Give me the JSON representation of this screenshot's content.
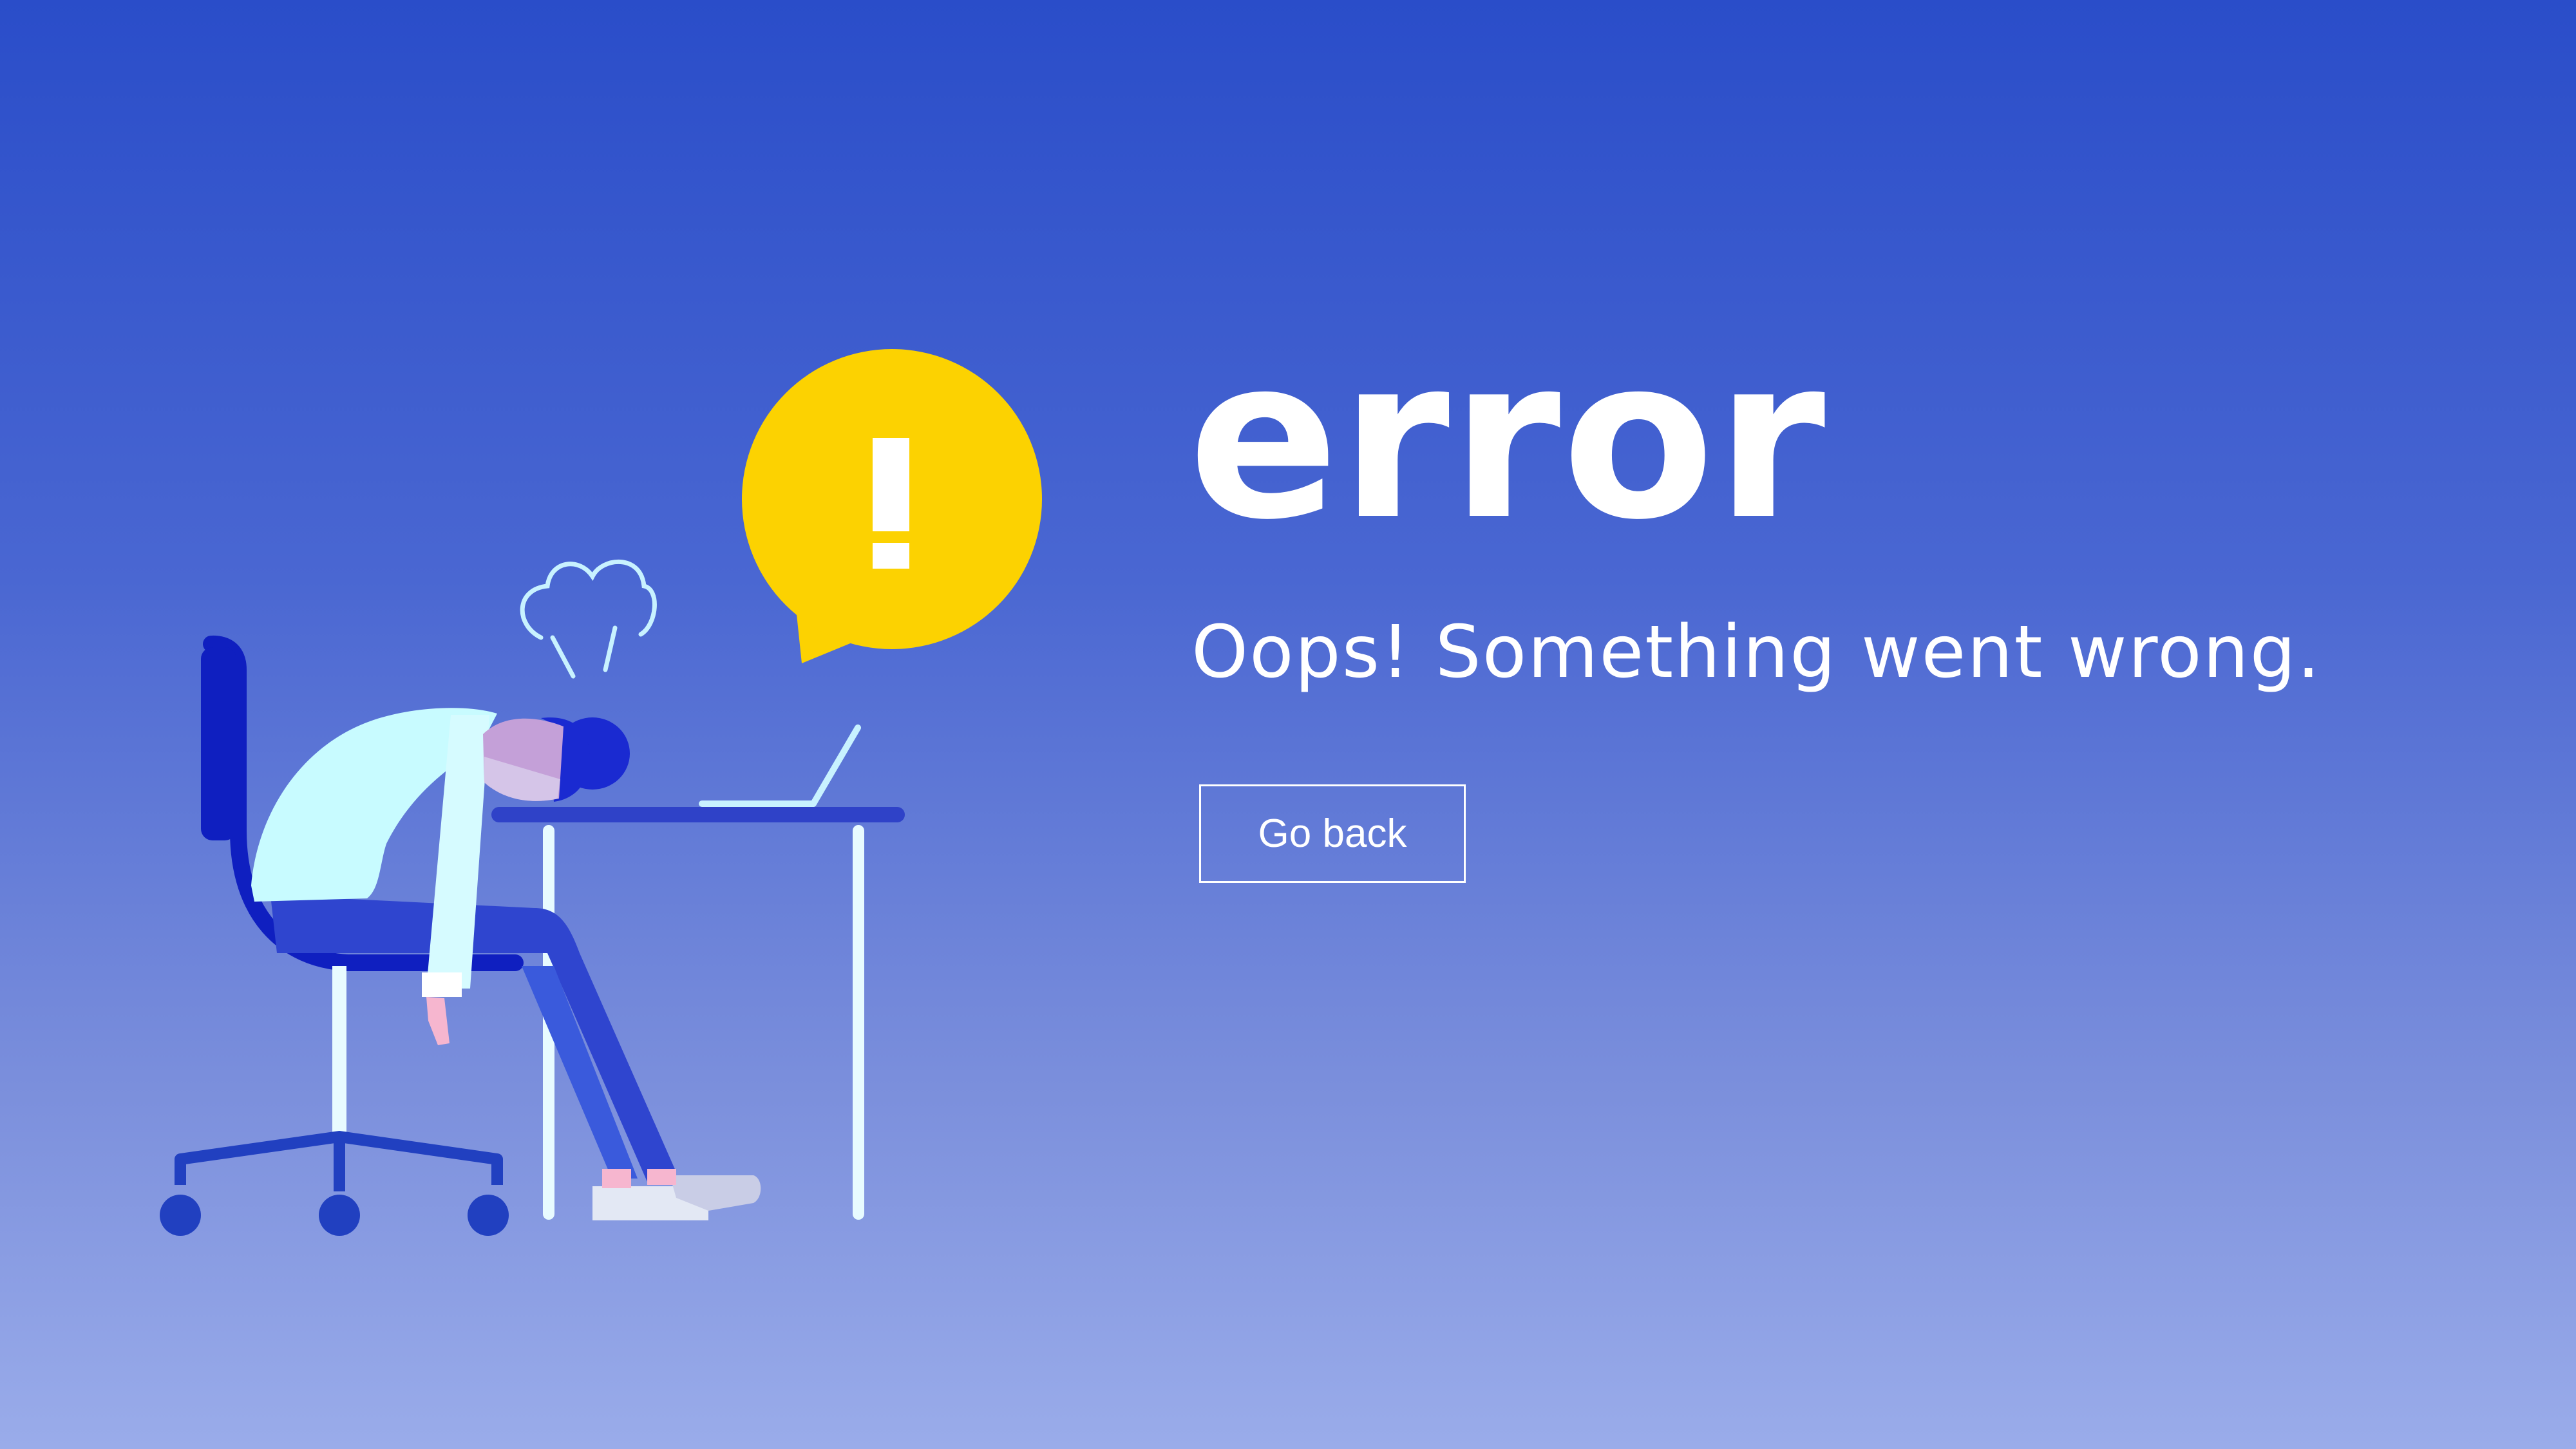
{
  "error_page": {
    "title": "error",
    "message": "Oops! Something went wrong.",
    "go_back_label": "Go back"
  },
  "icons": {
    "alert": "exclamation-speech-bubble-icon",
    "frustration": "steam-cloud-icon"
  },
  "colors": {
    "background_top": "#2a4dc9",
    "background_bottom": "#9aacea",
    "alert_yellow": "#fcd201",
    "chair_blue": "#0f1fc0",
    "desk_blue": "#2f42c8",
    "text_white": "#ffffff"
  }
}
